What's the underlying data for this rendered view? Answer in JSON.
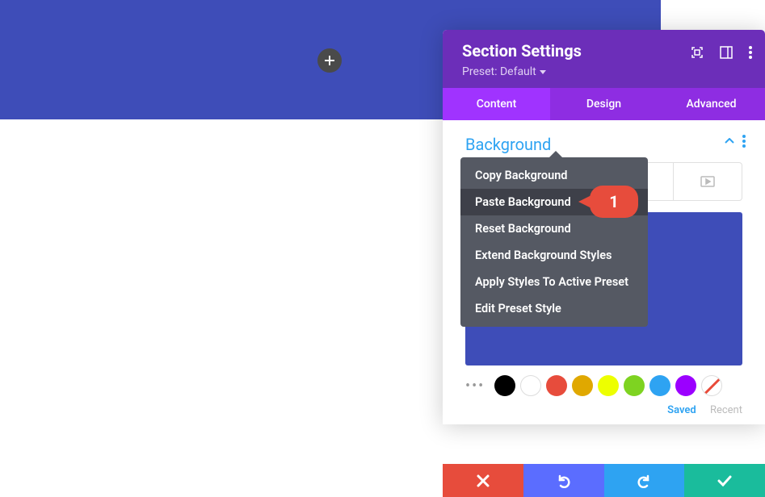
{
  "header": {
    "title": "Section Settings",
    "preset": "Preset: Default"
  },
  "tabs": {
    "content": "Content",
    "design": "Design",
    "advanced": "Advanced"
  },
  "section": {
    "title": "Background"
  },
  "menu": {
    "copy": "Copy Background",
    "paste": "Paste Background",
    "reset": "Reset Background",
    "extend": "Extend Background Styles",
    "apply": "Apply Styles To Active Preset",
    "edit": "Edit Preset Style"
  },
  "callout": {
    "number": "1"
  },
  "swatches": {
    "colors": [
      "#000000",
      "#FFFFFF",
      "#E74C3C",
      "#E0A800",
      "#EDFF00",
      "#7ED321",
      "#2EA3F2",
      "#9B00FF"
    ]
  },
  "tabs2": {
    "saved": "Saved",
    "recent": "Recent"
  },
  "preview": {
    "color": "#3E4DB8"
  }
}
